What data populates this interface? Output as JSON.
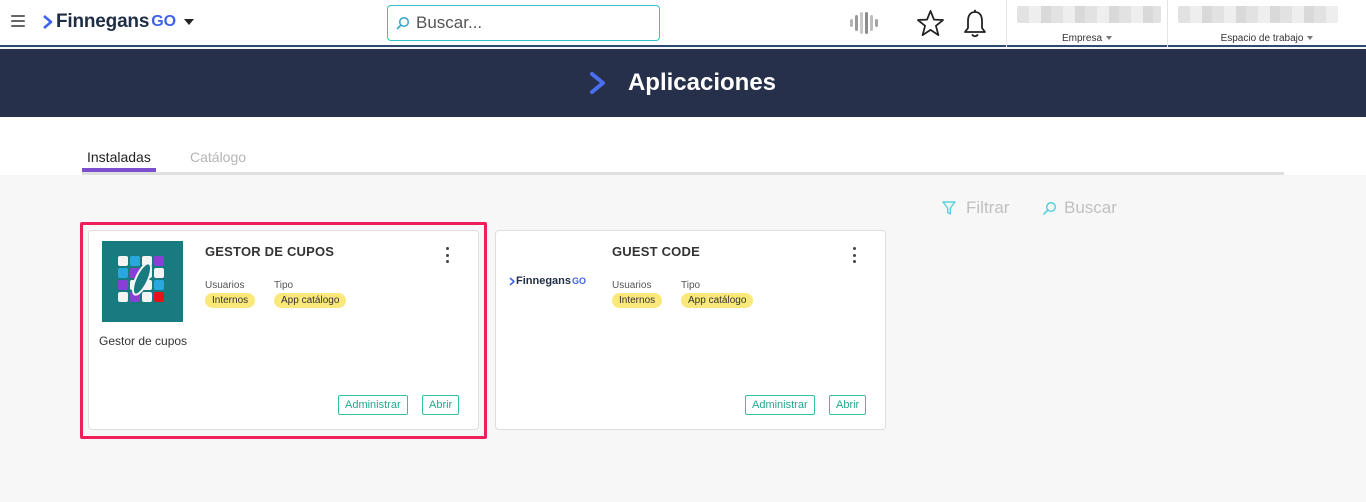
{
  "header": {
    "logo_text": "Finnegans",
    "logo_suffix": "GO",
    "search": {
      "placeholder": "Buscar..."
    },
    "selectors": [
      {
        "label": "Empresa"
      },
      {
        "label": "Espacio de trabajo"
      }
    ]
  },
  "banner": {
    "title": "Aplicaciones"
  },
  "tabs": [
    {
      "label": "Instaladas",
      "active": true
    },
    {
      "label": "Catálogo",
      "active": false
    }
  ],
  "tools": {
    "filter_label": "Filtrar",
    "search_label": "Buscar"
  },
  "cards": [
    {
      "title": "GESTOR DE CUPOS",
      "caption": "Gestor de cupos",
      "users_label": "Usuarios",
      "users_value": "Internos",
      "type_label": "Tipo",
      "type_value": "App catálogo",
      "manage_label": "Administrar",
      "open_label": "Abrir",
      "highlighted": true
    },
    {
      "title": "GUEST CODE",
      "logo_text": "Finnegans",
      "logo_suffix": "GO",
      "users_label": "Usuarios",
      "users_value": "Internos",
      "type_label": "Tipo",
      "type_value": "App catálogo",
      "manage_label": "Administrar",
      "open_label": "Abrir",
      "highlighted": false
    }
  ],
  "colors": {
    "banner_bg": "#26304a",
    "accent_blue": "#3f63e8",
    "tab_active": "#7b4fd0",
    "badge_yellow": "#fbe87a",
    "button_teal": "#22a88f",
    "highlight_pink": "#ef1f5c",
    "search_border": "#35c0c7"
  }
}
